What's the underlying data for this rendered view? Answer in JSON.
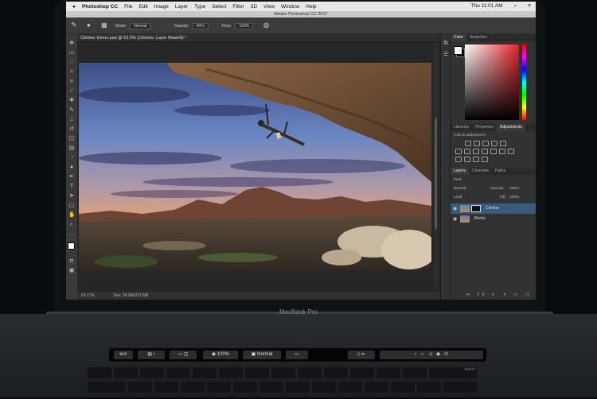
{
  "menubar": {
    "apple": "",
    "app": "Photoshop CC",
    "menus": [
      "File",
      "Edit",
      "Image",
      "Layer",
      "Type",
      "Select",
      "Filter",
      "3D",
      "View",
      "Window",
      "Help"
    ],
    "time": "Thu 11:01 AM"
  },
  "window_title": "Adobe Photoshop CC 2017",
  "options": {
    "mode_label": "Mode:",
    "mode_value": "Normal",
    "opacity_label": "Opacity:",
    "opacity_value": "40%",
    "flow_label": "Flow:",
    "flow_value": "100%"
  },
  "document": {
    "tab_title": "Climber Demo.psd @ 63.5% (Climber, Layer Mask/8) *",
    "zoom": "63.17%",
    "doc_size": "Doc: 18.0M/237.8M"
  },
  "panels": {
    "color_tabs": [
      "Color",
      "Swatches"
    ],
    "adjust_tabs": [
      "Libraries",
      "Properties",
      "Adjustments"
    ],
    "add_adjustment": "Add an adjustment",
    "layer_tabs": [
      "Layers",
      "Channels",
      "Paths"
    ],
    "kind": "Kind",
    "blend": "Normal",
    "opacity_label": "Opacity:",
    "opacity_value": "100%",
    "lock_label": "Lock:",
    "fill_label": "Fill:",
    "fill_value": "100%",
    "layers": [
      {
        "name": "Climber",
        "selected": true
      },
      {
        "name": "Rocks",
        "selected": false
      }
    ]
  },
  "device_label": "MacBook Pro",
  "touchbar": {
    "esc": "esc",
    "zoom": "100%",
    "blend": "Normal"
  },
  "keys": {
    "delete": "delete"
  },
  "colors": {
    "accent_layer": "#3a5a7a",
    "color_red": "#e5232a"
  }
}
